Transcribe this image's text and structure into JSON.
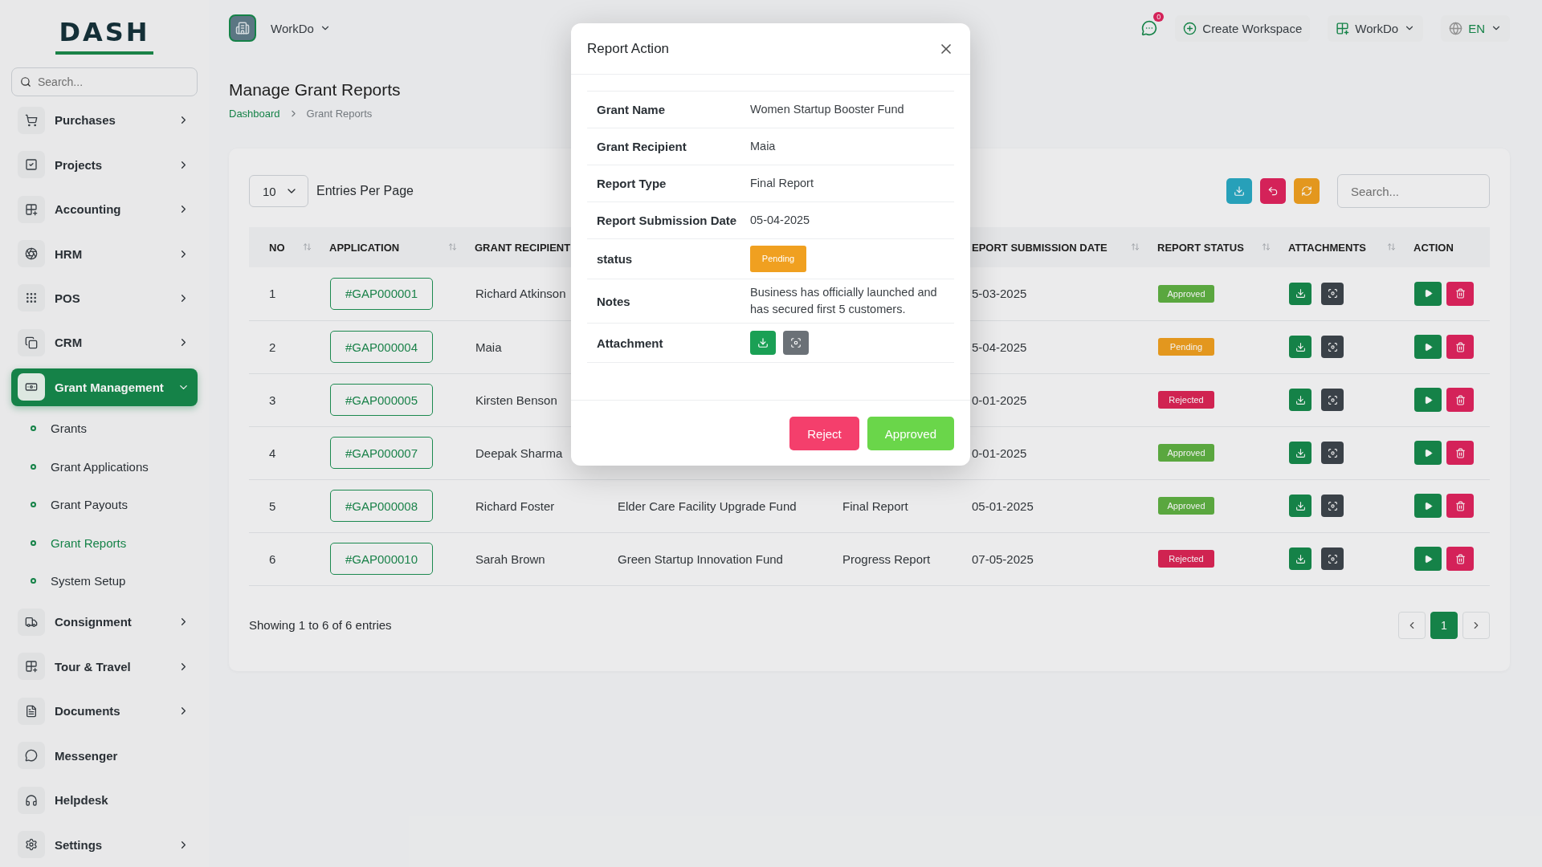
{
  "logo": "DASH",
  "sidebar": {
    "search_placeholder": "Search...",
    "items": [
      {
        "label": "Purchases",
        "has_submenu": true,
        "expanded": false,
        "selected": false
      },
      {
        "label": "Projects",
        "has_submenu": true,
        "expanded": false,
        "selected": false
      },
      {
        "label": "Accounting",
        "has_submenu": true,
        "expanded": false,
        "selected": false
      },
      {
        "label": "HRM",
        "has_submenu": true,
        "expanded": false,
        "selected": false
      },
      {
        "label": "POS",
        "has_submenu": true,
        "expanded": false,
        "selected": false
      },
      {
        "label": "CRM",
        "has_submenu": true,
        "expanded": false,
        "selected": false
      },
      {
        "label": "Grant Management",
        "has_submenu": true,
        "expanded": true,
        "selected": true,
        "children": [
          {
            "label": "Grants",
            "selected": false
          },
          {
            "label": "Grant Applications",
            "selected": false
          },
          {
            "label": "Grant Payouts",
            "selected": false
          },
          {
            "label": "Grant Reports",
            "selected": true
          },
          {
            "label": "System Setup",
            "selected": false
          }
        ]
      },
      {
        "label": "Consignment",
        "has_submenu": true,
        "expanded": false,
        "selected": false
      },
      {
        "label": "Tour & Travel",
        "has_submenu": true,
        "expanded": false,
        "selected": false
      },
      {
        "label": "Documents",
        "has_submenu": true,
        "expanded": false,
        "selected": false
      },
      {
        "label": "Messenger",
        "has_submenu": false,
        "expanded": false,
        "selected": false
      },
      {
        "label": "Helpdesk",
        "has_submenu": false,
        "expanded": false,
        "selected": false
      },
      {
        "label": "Settings",
        "has_submenu": true,
        "expanded": false,
        "selected": false
      }
    ]
  },
  "topbar": {
    "workspace": "WorkDo",
    "notification_count": "0",
    "create_workspace": "Create Workspace",
    "workspace_menu": "WorkDo",
    "language": "EN"
  },
  "page": {
    "title": "Manage Grant Reports",
    "breadcrumb": [
      "Dashboard",
      "Grant Reports"
    ]
  },
  "table_controls": {
    "entries": "10",
    "entries_label": "Entries Per Page",
    "search_placeholder": "Search..."
  },
  "table": {
    "columns": [
      {
        "label": "NO",
        "sortable": true
      },
      {
        "label": "APPLICATION",
        "sortable": true
      },
      {
        "label": "GRANT RECIPIENT",
        "sortable": false
      },
      {},
      {},
      {
        "label": "EPORT SUBMISSION DATE",
        "sortable": true
      },
      {
        "label": "REPORT STATUS",
        "sortable": true
      },
      {
        "label": "ATTACHMENTS",
        "sortable": true
      },
      {
        "label": "ACTION",
        "sortable": false
      }
    ],
    "rows": [
      {
        "no": "1",
        "application": "#GAP000001",
        "recipient": "Richard Atkinson",
        "date": "5-03-2025",
        "status": {
          "label": "Approved",
          "kind": "approved"
        }
      },
      {
        "no": "2",
        "application": "#GAP000004",
        "recipient": "Maia",
        "date": "5-04-2025",
        "status": {
          "label": "Pending",
          "kind": "pending"
        }
      },
      {
        "no": "3",
        "application": "#GAP000005",
        "recipient": "Kirsten Benson",
        "date": "0-01-2025",
        "status": {
          "label": "Rejected",
          "kind": "rejected"
        }
      },
      {
        "no": "4",
        "application": "#GAP000007",
        "recipient": "Deepak Sharma",
        "date": "0-01-2025",
        "status": {
          "label": "Approved",
          "kind": "approved"
        }
      },
      {
        "no": "5",
        "application": "#GAP000008",
        "recipient": "Richard Foster",
        "grant_name": "Elder Care Facility Upgrade Fund",
        "report_type": "Final Report",
        "date": "05-01-2025",
        "status": {
          "label": "Approved",
          "kind": "approved"
        }
      },
      {
        "no": "6",
        "application": "#GAP000010",
        "recipient": "Sarah Brown",
        "grant_name": "Green Startup Innovation Fund",
        "report_type": "Progress Report",
        "date": "07-05-2025",
        "status": {
          "label": "Rejected",
          "kind": "rejected"
        }
      }
    ]
  },
  "footer": {
    "summary": "Showing 1 to 6 of 6 entries",
    "pages": [
      {
        "label": "1",
        "selected": true
      }
    ]
  },
  "modal": {
    "title": "Report Action",
    "fields": [
      {
        "kind": "text",
        "label": "Grant Name",
        "value": "Women Startup Booster Fund"
      },
      {
        "kind": "text",
        "label": "Grant Recipient",
        "value": "Maia"
      },
      {
        "kind": "text",
        "label": "Report Type",
        "value": "Final Report"
      },
      {
        "kind": "text",
        "label": "Report Submission Date",
        "value": "05-04-2025"
      },
      {
        "kind": "badge",
        "label": "status",
        "value": {
          "label": "Pending",
          "kind": "pending"
        }
      },
      {
        "kind": "text",
        "label": "Notes",
        "value": "Business has officially launched and has secured first 5 customers."
      },
      {
        "kind": "attachment",
        "label": "Attachment"
      }
    ],
    "buttons": [
      {
        "label": "Reject",
        "kind": "danger"
      },
      {
        "label": "Approved",
        "kind": "success"
      }
    ]
  }
}
